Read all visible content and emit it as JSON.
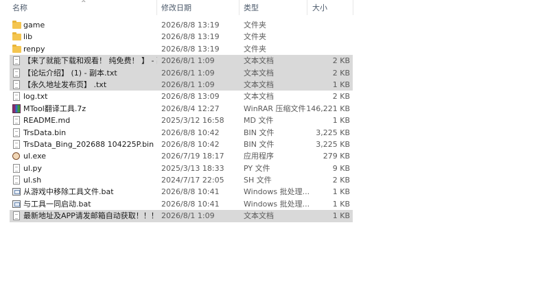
{
  "columns": {
    "name": "名称",
    "date": "修改日期",
    "type": "类型",
    "size": "大小"
  },
  "files": [
    {
      "icon": "folder-icon",
      "name": "game",
      "date": "2026/8/8 13:19",
      "type": "文件夹",
      "size": "",
      "selected": false
    },
    {
      "icon": "folder-icon",
      "name": "lib",
      "date": "2026/8/8 13:19",
      "type": "文件夹",
      "size": "",
      "selected": false
    },
    {
      "icon": "folder-icon",
      "name": "renpy",
      "date": "2026/8/8 13:19",
      "type": "文件夹",
      "size": "",
      "selected": false
    },
    {
      "icon": "text-file-icon",
      "name": "【来了就能下载和观看！ 纯免费！ 】 - 副...",
      "date": "2026/8/1 1:09",
      "type": "文本文档",
      "size": "2 KB",
      "selected": true
    },
    {
      "icon": "text-file-icon",
      "name": "【论坛介绍】 (1) - 副本.txt",
      "date": "2026/8/1 1:09",
      "type": "文本文档",
      "size": "2 KB",
      "selected": true
    },
    {
      "icon": "text-file-icon",
      "name": "【永久地址发布页】 .txt",
      "date": "2026/8/1 1:09",
      "type": "文本文档",
      "size": "1 KB",
      "selected": true
    },
    {
      "icon": "text-file-icon",
      "name": "log.txt",
      "date": "2026/8/8 13:09",
      "type": "文本文档",
      "size": "2 KB",
      "selected": false
    },
    {
      "icon": "winrar-archive-icon",
      "name": "MTool翻译工具.7z",
      "date": "2026/8/4 12:27",
      "type": "WinRAR 压缩文件",
      "size": "146,221 KB",
      "selected": false
    },
    {
      "icon": "file-icon",
      "name": "README.md",
      "date": "2025/3/12 16:58",
      "type": "MD 文件",
      "size": "1 KB",
      "selected": false
    },
    {
      "icon": "file-icon",
      "name": "TrsData.bin",
      "date": "2026/8/8 10:42",
      "type": "BIN 文件",
      "size": "3,225 KB",
      "selected": false
    },
    {
      "icon": "file-icon",
      "name": "TrsData_Bing_202688 104225P.bin",
      "date": "2026/8/8 10:42",
      "type": "BIN 文件",
      "size": "3,225 KB",
      "selected": false
    },
    {
      "icon": "application-icon",
      "name": "ul.exe",
      "date": "2026/7/19 18:17",
      "type": "应用程序",
      "size": "279 KB",
      "selected": false
    },
    {
      "icon": "file-icon",
      "name": "ul.py",
      "date": "2025/3/13 18:33",
      "type": "PY 文件",
      "size": "9 KB",
      "selected": false
    },
    {
      "icon": "file-icon",
      "name": "ul.sh",
      "date": "2024/7/17 22:05",
      "type": "SH 文件",
      "size": "2 KB",
      "selected": false
    },
    {
      "icon": "batch-file-icon",
      "name": "从游戏中移除工具文件.bat",
      "date": "2026/8/8 10:41",
      "type": "Windows 批处理...",
      "size": "1 KB",
      "selected": false
    },
    {
      "icon": "batch-file-icon",
      "name": "与工具一同启动.bat",
      "date": "2026/8/8 10:41",
      "type": "Windows 批处理...",
      "size": "1 KB",
      "selected": false
    },
    {
      "icon": "text-file-icon",
      "name": "最新地址及APP请发邮箱自动获取！！！...",
      "date": "2026/8/1 1:09",
      "type": "文本文档",
      "size": "1 KB",
      "selected": true
    }
  ]
}
